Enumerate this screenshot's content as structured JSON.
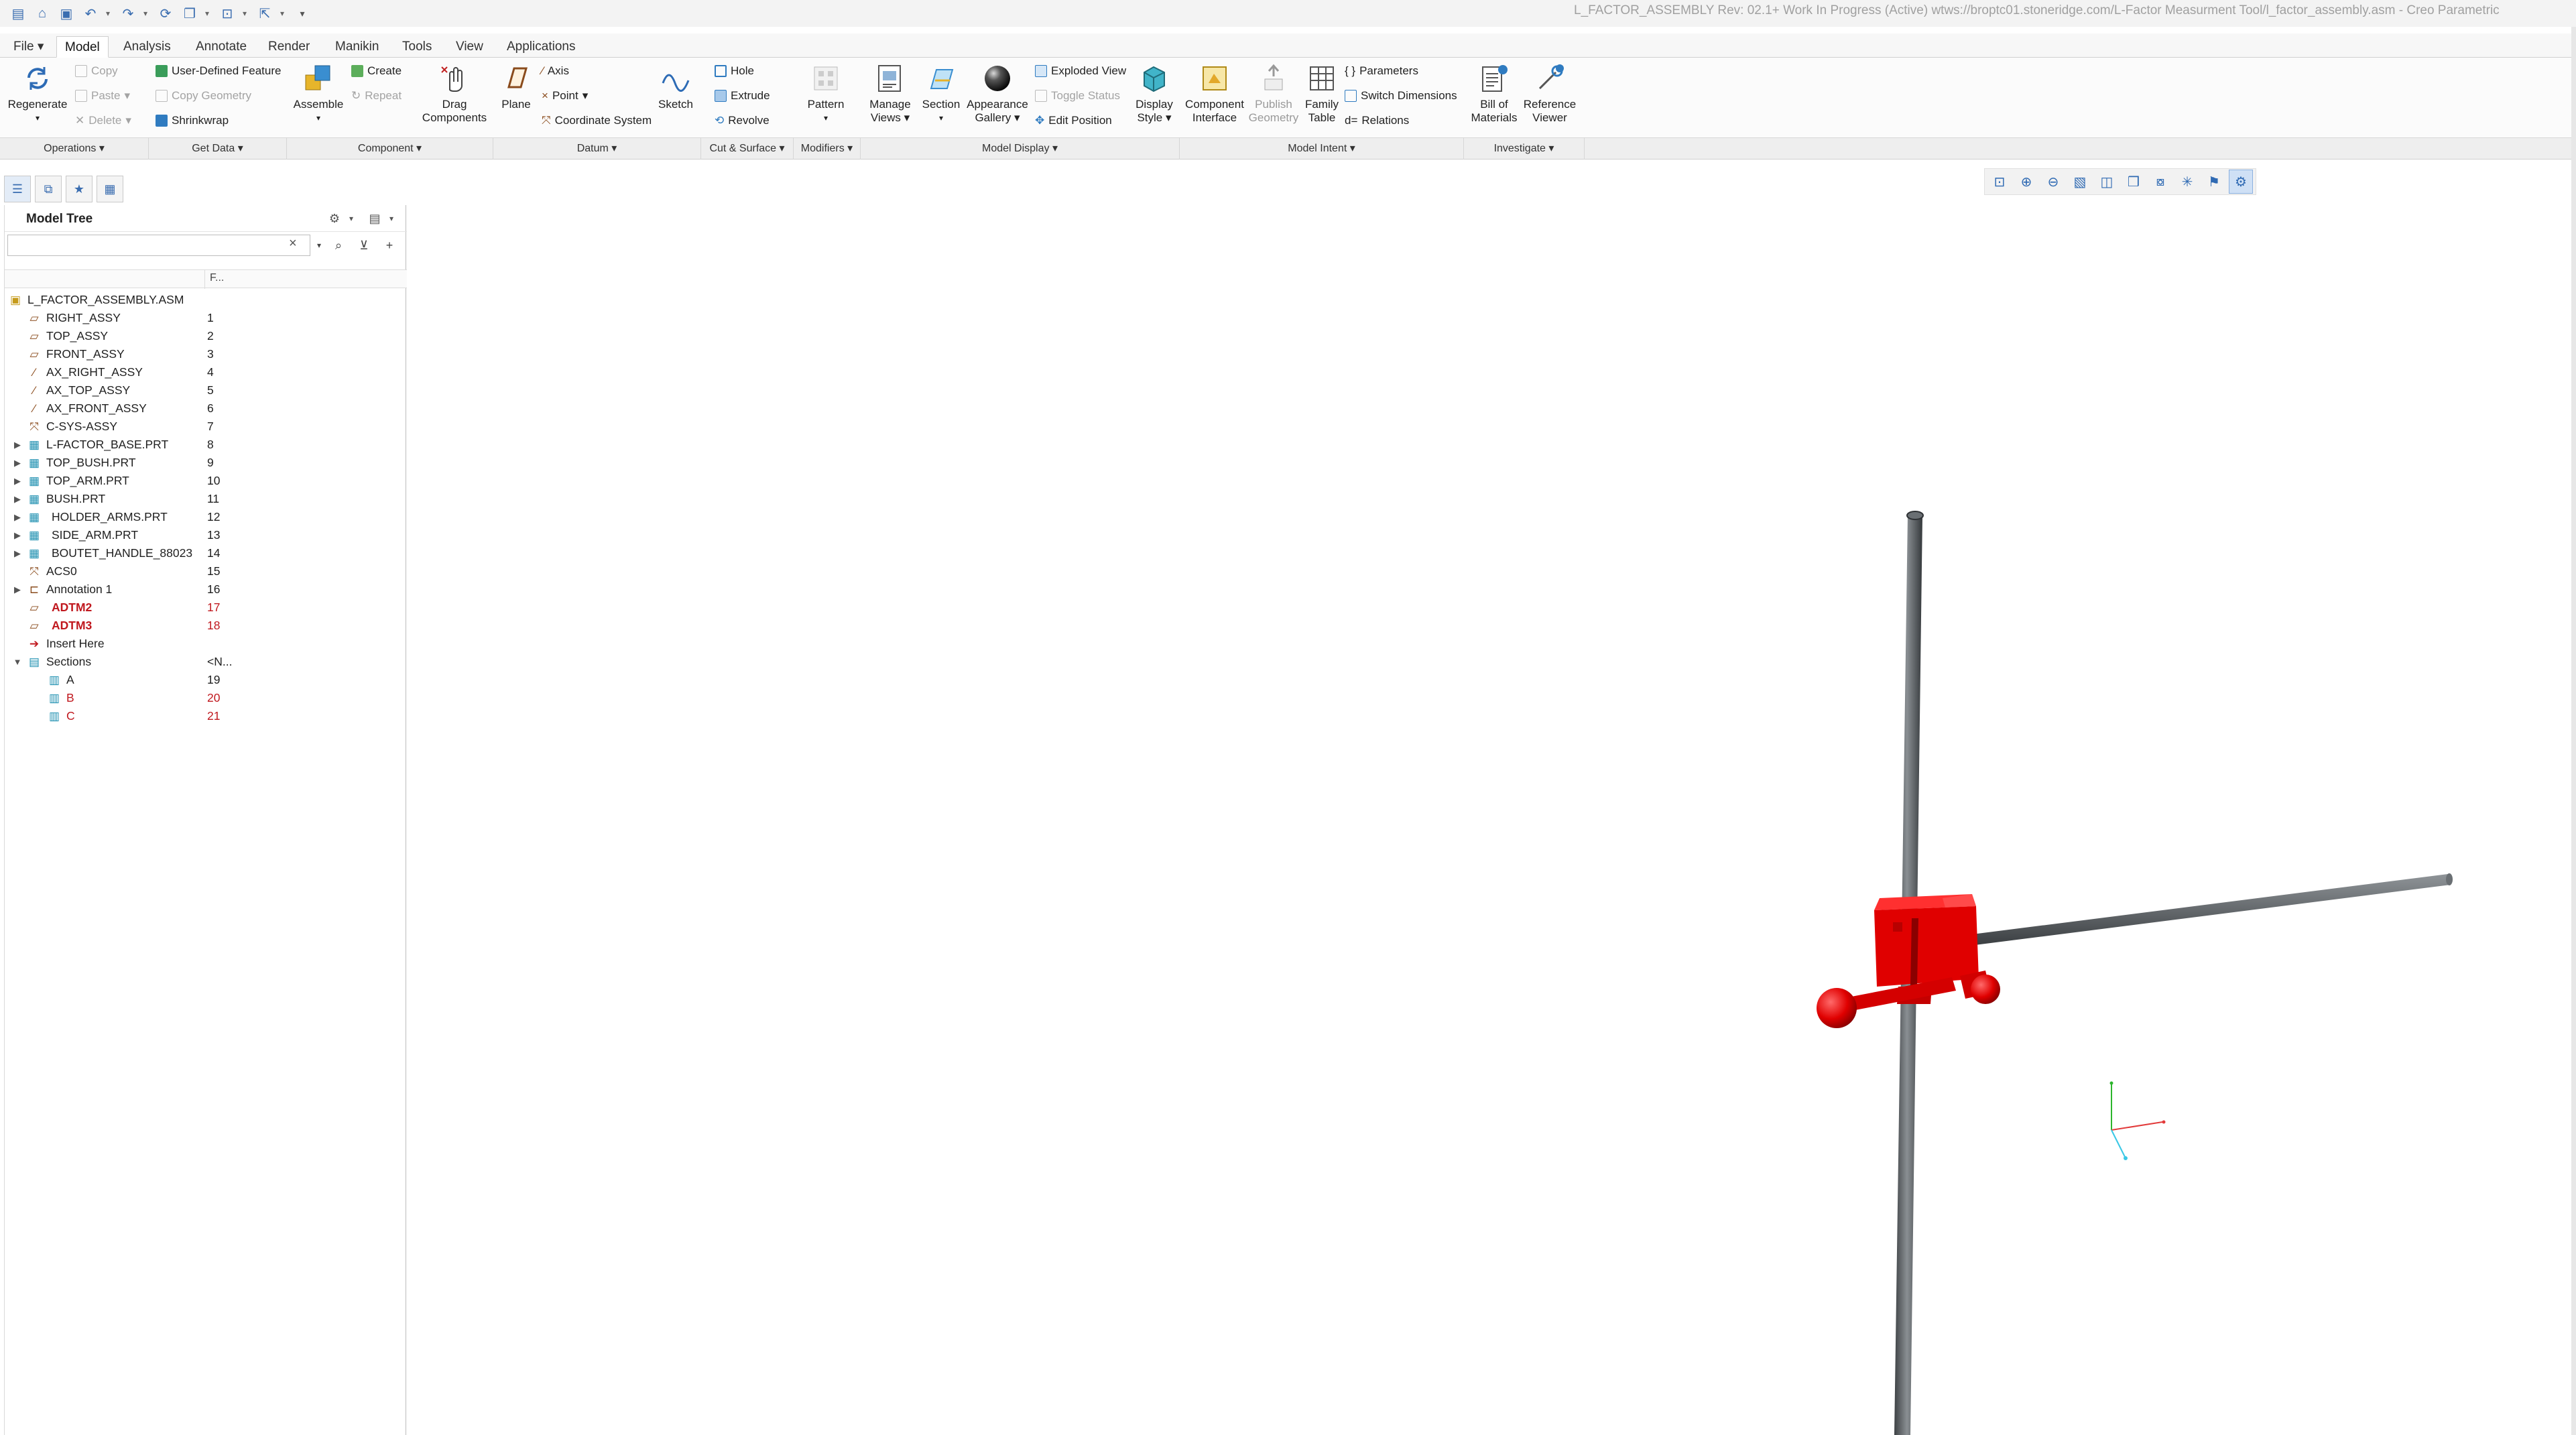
{
  "window": {
    "title": "L_FACTOR_ASSEMBLY Rev: 02.1+ Work In Progress  (Active) wtws://broptc01.stoneridge.com/L-Factor Measurment Tool/l_factor_assembly.asm - Creo Parametric"
  },
  "quick_access": [
    "new-icon",
    "open-icon",
    "save-icon",
    "undo-icon",
    "redo-icon",
    "regenerate-icon",
    "windows-icon",
    "close-icon",
    "select-icon",
    "customize-icon"
  ],
  "tabs": [
    {
      "label": "File"
    },
    {
      "label": "Model"
    },
    {
      "label": "Analysis"
    },
    {
      "label": "Annotate"
    },
    {
      "label": "Render"
    },
    {
      "label": "Manikin"
    },
    {
      "label": "Tools"
    },
    {
      "label": "View"
    },
    {
      "label": "Applications"
    }
  ],
  "ribbon": {
    "regenerate": "Regenerate",
    "copy": "Copy",
    "paste": "Paste",
    "delete": "Delete",
    "user_defined_feature": "User-Defined Feature",
    "copy_geometry": "Copy Geometry",
    "shrinkwrap": "Shrinkwrap",
    "assemble": "Assemble",
    "create": "Create",
    "repeat": "Repeat",
    "drag_components_1": "Drag",
    "drag_components_2": "Components",
    "plane": "Plane",
    "axis": "Axis",
    "point": "Point",
    "coordinate_system": "Coordinate System",
    "sketch": "Sketch",
    "hole": "Hole",
    "extrude": "Extrude",
    "revolve": "Revolve",
    "pattern": "Pattern",
    "manage_views_1": "Manage",
    "manage_views_2": "Views",
    "section": "Section",
    "appearance_gallery_1": "Appearance",
    "appearance_gallery_2": "Gallery",
    "exploded_view": "Exploded View",
    "toggle_status": "Toggle Status",
    "edit_position": "Edit Position",
    "display_style_1": "Display",
    "display_style_2": "Style",
    "component_interface_1": "Component",
    "component_interface_2": "Interface",
    "publish_geometry_1": "Publish",
    "publish_geometry_2": "Geometry",
    "family_table_1": "Family",
    "family_table_2": "Table",
    "parameters": "Parameters",
    "switch_dimensions": "Switch Dimensions",
    "relations": "Relations",
    "bill_of_materials_1": "Bill of",
    "bill_of_materials_2": "Materials",
    "reference_viewer_1": "Reference",
    "reference_viewer_2": "Viewer"
  },
  "groups": [
    {
      "label": "Operations ▾"
    },
    {
      "label": "Get Data ▾"
    },
    {
      "label": "Component ▾"
    },
    {
      "label": "Datum ▾"
    },
    {
      "label": "Cut & Surface ▾"
    },
    {
      "label": "Modifiers ▾"
    },
    {
      "label": "Model Display ▾"
    },
    {
      "label": "Model Intent ▾"
    },
    {
      "label": "Investigate ▾"
    }
  ],
  "model_tree": {
    "title": "Model Tree",
    "search_value": "",
    "column_header": "F...",
    "rows": [
      {
        "label": "L_FACTOR_ASSEMBLY.ASM",
        "num": "",
        "icon": "assembly-icon"
      },
      {
        "label": "RIGHT_ASSY",
        "num": "1",
        "icon": "datum-plane-icon"
      },
      {
        "label": "TOP_ASSY",
        "num": "2",
        "icon": "datum-plane-icon"
      },
      {
        "label": "FRONT_ASSY",
        "num": "3",
        "icon": "datum-plane-icon"
      },
      {
        "label": "AX_RIGHT_ASSY",
        "num": "4",
        "icon": "datum-axis-icon"
      },
      {
        "label": "AX_TOP_ASSY",
        "num": "5",
        "icon": "datum-axis-icon"
      },
      {
        "label": "AX_FRONT_ASSY",
        "num": "6",
        "icon": "datum-axis-icon"
      },
      {
        "label": "C-SYS-ASSY",
        "num": "7",
        "icon": "csys-icon"
      },
      {
        "label": "L-FACTOR_BASE.PRT",
        "num": "8",
        "icon": "part-icon"
      },
      {
        "label": "TOP_BUSH.PRT",
        "num": "9",
        "icon": "part-icon"
      },
      {
        "label": "TOP_ARM.PRT",
        "num": "10",
        "icon": "part-icon"
      },
      {
        "label": "BUSH.PRT",
        "num": "11",
        "icon": "part-icon"
      },
      {
        "label": "HOLDER_ARMS.PRT",
        "num": "12",
        "icon": "part-icon"
      },
      {
        "label": "SIDE_ARM.PRT",
        "num": "13",
        "icon": "part-icon"
      },
      {
        "label": "BOUTET_HANDLE_88023",
        "num": "14",
        "icon": "part-icon"
      },
      {
        "label": "ACS0",
        "num": "15",
        "icon": "csys-icon"
      },
      {
        "label": "Annotation 1",
        "num": "16",
        "icon": "annotation-icon"
      },
      {
        "label": "ADTM2",
        "num": "17",
        "icon": "datum-plane-icon"
      },
      {
        "label": "ADTM3",
        "num": "18",
        "icon": "datum-plane-icon"
      },
      {
        "label": "Insert Here",
        "num": "",
        "icon": "insert-arrow-icon"
      },
      {
        "label": "Sections",
        "num": "<N...",
        "icon": "sections-icon"
      },
      {
        "label": "A",
        "num": "19",
        "icon": "section-icon"
      },
      {
        "label": "B",
        "num": "20",
        "icon": "section-icon"
      },
      {
        "label": "C",
        "num": "21",
        "icon": "section-icon"
      }
    ]
  },
  "view_toolbar": [
    "refit-icon",
    "zoom-in-icon",
    "zoom-out-icon",
    "repaint-icon",
    "display-style-icon",
    "saved-views-icon",
    "view-manager-icon",
    "datum-display-icon",
    "annotation-display-icon",
    "spin-center-icon"
  ],
  "colors": {
    "accent": "#3a6db0",
    "model_red": "#e00000",
    "rod_gray": "#5f6468",
    "warning_red": "#c0181e"
  }
}
